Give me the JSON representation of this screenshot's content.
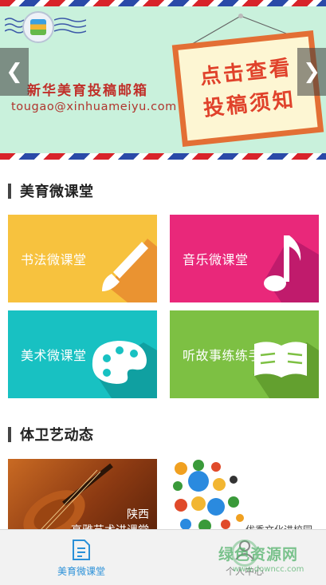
{
  "banner": {
    "title": "新华美育投稿邮箱",
    "email": "tougao@xinhuameiyu.com",
    "sign_line1": "点击查看",
    "sign_line2": "投稿须知",
    "prev_glyph": "❮",
    "next_glyph": "❯"
  },
  "sections": {
    "micro_class_title": "美育微课堂",
    "news_title": "体卫艺动态"
  },
  "tiles": [
    {
      "label": "书法微课堂",
      "color": "#f7c23e",
      "icon": "brush-icon"
    },
    {
      "label": "音乐微课堂",
      "color": "#e9287a",
      "icon": "music-note-icon"
    },
    {
      "label": "美术微课堂",
      "color": "#18c1c2",
      "icon": "palette-icon"
    },
    {
      "label": "听故事练练手",
      "color": "#7dc043",
      "icon": "book-icon"
    }
  ],
  "news": [
    {
      "caption_line1": "陕西",
      "caption_line2": "高雅艺术进课堂"
    },
    {
      "caption": "优秀文化进校园"
    }
  ],
  "bottom_nav": {
    "home_label": "美育微课堂",
    "me_label": "个人中心",
    "active_color": "#2a90d8"
  },
  "watermark": {
    "title": "绿色资源网",
    "url": "www.downcc.com"
  }
}
